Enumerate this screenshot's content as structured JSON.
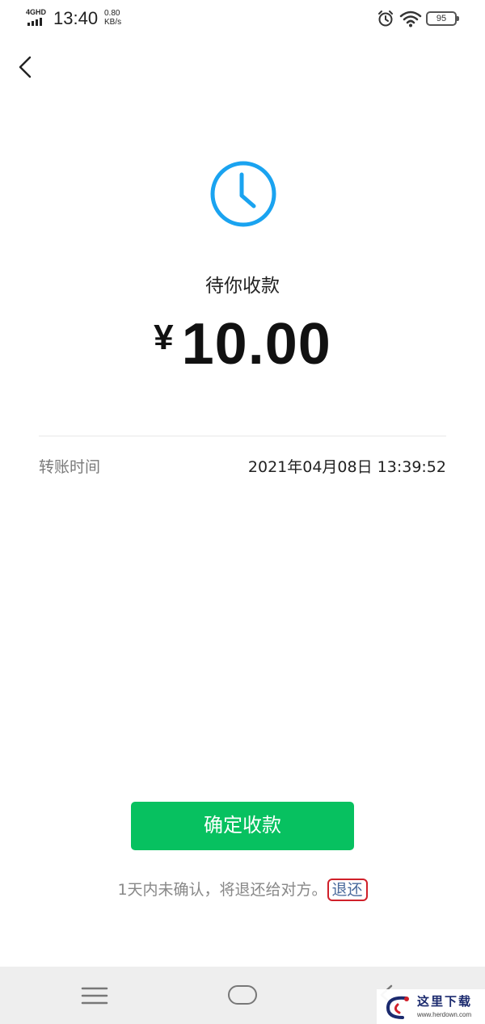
{
  "status_bar": {
    "network": "4GHD",
    "time": "13:40",
    "speed_value": "0.80",
    "speed_unit": "KB/s",
    "battery": "95",
    "icons": [
      "signal-icon",
      "alarm-icon",
      "wifi-icon",
      "battery-icon"
    ]
  },
  "header": {
    "back_icon": "chevron-left-icon"
  },
  "transfer": {
    "status_icon": "clock-icon",
    "status_text": "待你收款",
    "currency": "¥",
    "amount": "10.00",
    "time_label": "转账时间",
    "time_value": "2021年04月08日 13:39:52"
  },
  "actions": {
    "confirm_label": "确定收款",
    "notice_text": "1天内未确认，将退还给对方。",
    "refund_label": "退还"
  },
  "nav_bar": {
    "icons": [
      "menu-icon",
      "home-icon",
      "back-icon"
    ]
  },
  "watermark": {
    "text": "这里下载",
    "url": "www.herdown.com"
  },
  "colors": {
    "accent_green": "#07c160",
    "clock_blue": "#1aa3f0",
    "link_blue": "#4a6a9c",
    "highlight_red": "#d0202a"
  }
}
